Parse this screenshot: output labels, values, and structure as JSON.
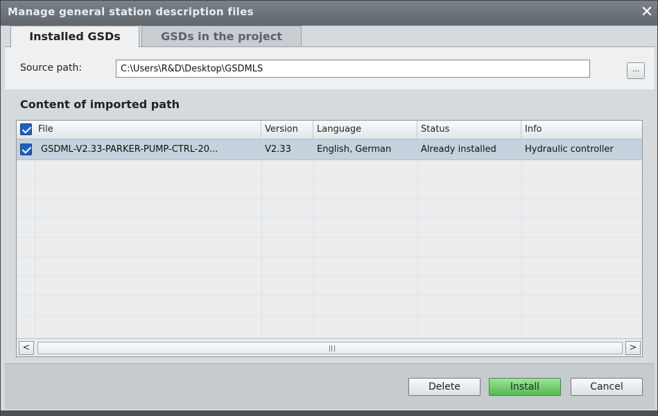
{
  "window": {
    "title": "Manage general station description files"
  },
  "tabs": [
    {
      "label": "Installed GSDs",
      "active": true
    },
    {
      "label": "GSDs in the project",
      "active": false
    }
  ],
  "source": {
    "label": "Source path:",
    "value": "C:\\Users\\R&D\\Desktop\\GSDMLS",
    "browse_label": "..."
  },
  "content": {
    "title": "Content of imported path",
    "columns": [
      "File",
      "Version",
      "Language",
      "Status",
      "Info"
    ],
    "rows": [
      {
        "checked": true,
        "file": "GSDML-V2.33-PARKER-PUMP-CTRL-20...",
        "version": "V2.33",
        "language": "English, German",
        "status": "Already installed",
        "info": "Hydraulic controller"
      }
    ]
  },
  "scrollbar": {
    "left_arrow": "<",
    "right_arrow": ">"
  },
  "buttons": {
    "delete": "Delete",
    "install": "Install",
    "cancel": "Cancel"
  },
  "colors": {
    "install_accent": "#55b852",
    "selection_row": "#c5d2dd",
    "checkbox": "#1f5fbf"
  },
  "icons": {
    "close": "close-icon",
    "checkbox": "checkbox-checked-icon"
  }
}
